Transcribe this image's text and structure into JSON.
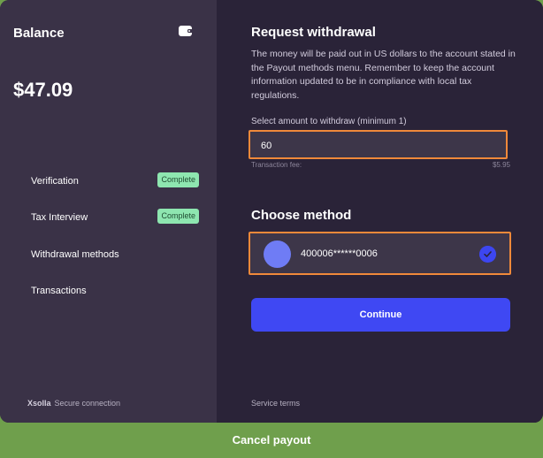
{
  "left": {
    "balance_title": "Balance",
    "wallet_icon": "wallet-icon",
    "balance_amount": "$47.09",
    "menu": [
      {
        "label": "Verification",
        "badge": "Complete"
      },
      {
        "label": "Tax Interview",
        "badge": "Complete"
      },
      {
        "label": "Withdrawal methods"
      },
      {
        "label": "Transactions"
      }
    ],
    "footer_brand": "Xsolla",
    "footer_text": "Secure connection"
  },
  "right": {
    "title": "Request withdrawal",
    "description": "The money will be paid out in US dollars to the account stated in the Payout methods menu. Remember to keep the account information updated to be in compliance with local tax regulations.",
    "amount_label": "Select amount to withdraw (minimum 1)",
    "amount_value": "60",
    "fee_label": "Transaction fee:",
    "fee_value": "$5.95",
    "method_title": "Choose method",
    "method_number": "400006******0006",
    "continue_label": "Continue",
    "service_terms": "Service terms"
  },
  "cancel_label": "Cancel payout",
  "colors": {
    "accent": "#3f48f3",
    "highlight": "#f0893a",
    "cancel_bar": "#6f9f4c",
    "badge": "#8ee6b0"
  }
}
